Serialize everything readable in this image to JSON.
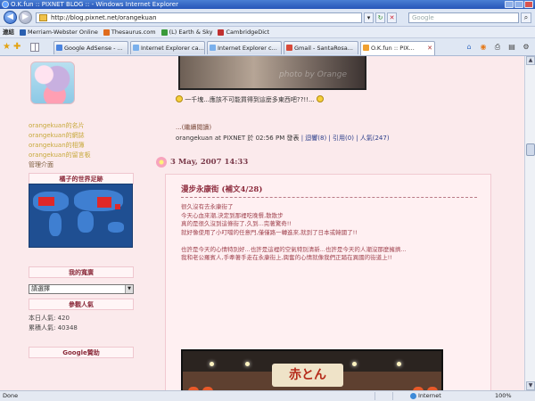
{
  "window": {
    "title": "O.K.fun :: PIXNET BLOG :: - Windows Internet Explorer"
  },
  "address": {
    "url": "http://blog.pixnet.net/orangekuan",
    "search_placeholder": "Google"
  },
  "links_bar": {
    "label": "連結",
    "items": [
      "Merriam-Webster Online",
      "Thesaurus.com",
      "(L) Earth & Sky",
      "CambridgeDict"
    ]
  },
  "tabs": [
    {
      "label": "Google AdSense - ..."
    },
    {
      "label": "Internet Explorer ca..."
    },
    {
      "label": "Internet Explorer c..."
    },
    {
      "label": "Gmail - SantaRosa..."
    },
    {
      "label": "O.K.fun :: PIX..."
    }
  ],
  "sidebar": {
    "links": [
      "orangekuan的名片",
      "orangekuan的網誌",
      "orangekuan的相簿",
      "orangekuan的留言板",
      "管理介面"
    ],
    "headings": {
      "footprint": "橘子的世界足跡",
      "translate": "我的寬廣",
      "visitors": "參觀人氣",
      "google": "Google贊助"
    },
    "language_select": "請選擇",
    "stats": {
      "today": "本日人氣: 420",
      "total": "累積人氣: 40348"
    }
  },
  "main": {
    "image_watermark": "photo by Orange",
    "caption": "一千塊...應該不可能買得到這麼多東西吧??!!...",
    "read_more": "...(繼續閱讀)",
    "meta_author": "orangekuan at PIXNET 於 02:56 PM 發表",
    "meta_links": "| 迴響(8) | 引用(0) | 人氣(247)",
    "date": "3 May, 2007 14:33",
    "post_title": "漫步永康街 (補文4/28)",
    "post_body": [
      "很久沒有去永康街了",
      "今天心血來潮,決定到那裡吃晚餐,散散步",
      "真的是很久沒到這條街了,久到...完著驚奇!!",
      "就好像使用了小叮噹的任意門,僅僅路一轉進來,就到了日本或韓國了!!",
      "",
      "也許是今天的心情特別好...也許是這裡的空氣特別清新...也許是今天的人潮沒那麼擁擠...",
      "我和老公羅賓人,手牽著手走在永康街上,興奮的心情就像我們正踏在異國的街道上!!"
    ],
    "photo_sign": "赤とん"
  },
  "status": {
    "left": "Done",
    "zone": "Internet",
    "zoom": "100%"
  }
}
